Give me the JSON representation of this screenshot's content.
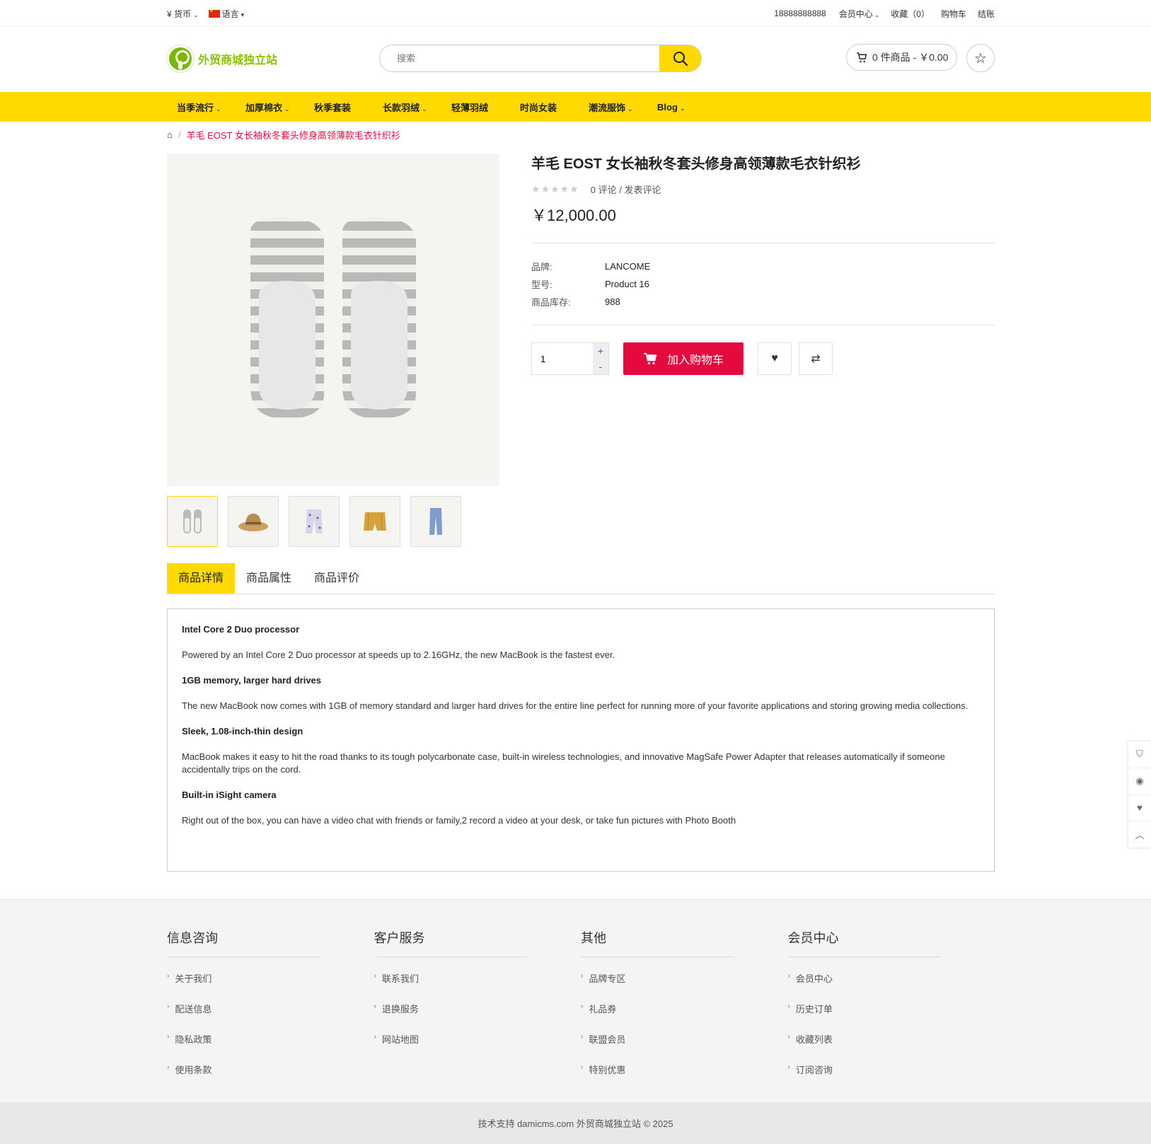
{
  "topbar": {
    "currency": "¥ 货币",
    "language": "语言",
    "phone": "18888888888",
    "account": "会员中心",
    "wishlist": "收藏（0）",
    "cart": "购物车",
    "checkout": "结账"
  },
  "header": {
    "logo_text": "外贸商城独立站",
    "search_placeholder": "搜索",
    "cart_summary": "0 件商品 - ￥0.00"
  },
  "nav": {
    "items": [
      {
        "label": "当季流行",
        "dropdown": true
      },
      {
        "label": "加厚棉衣",
        "dropdown": true
      },
      {
        "label": "秋季套装",
        "dropdown": false
      },
      {
        "label": "长款羽绒",
        "dropdown": true
      },
      {
        "label": "轻薄羽绒",
        "dropdown": false
      },
      {
        "label": "时尚女装",
        "dropdown": false
      },
      {
        "label": "潮流服饰",
        "dropdown": true
      },
      {
        "label": "Blog",
        "dropdown": true
      }
    ]
  },
  "breadcrumb": {
    "current": "羊毛 EOST 女长袖秋冬套头修身高领薄款毛衣针织衫"
  },
  "product": {
    "title": "羊毛 EOST 女长袖秋冬套头修身高领薄款毛衣针织衫",
    "rating": 0,
    "reviews_link": "0 评论",
    "write_review": "发表评论",
    "price": "￥12,000.00",
    "specs": [
      {
        "key": "品牌:",
        "value": "LANCOME"
      },
      {
        "key": "型号:",
        "value": "Product 16"
      },
      {
        "key": "商品库存:",
        "value": "988"
      }
    ],
    "quantity": "1",
    "add_to_cart": "加入购物车",
    "thumbnails": [
      "slippers",
      "straw-hat",
      "floral-pants",
      "yellow-shorts",
      "jeans"
    ]
  },
  "tabs": [
    {
      "label": "商品详情",
      "active": true
    },
    {
      "label": "商品属性",
      "active": false
    },
    {
      "label": "商品评价",
      "active": false
    }
  ],
  "description": [
    {
      "heading": "Intel Core 2 Duo processor",
      "body": "Powered by an Intel Core 2 Duo processor at speeds up to 2.16GHz, the new MacBook is the fastest ever."
    },
    {
      "heading": "1GB memory, larger hard drives",
      "body": "The new MacBook now comes with 1GB of memory standard and larger hard drives for the entire line perfect for running more of your favorite applications and storing growing media collections."
    },
    {
      "heading": "Sleek, 1.08-inch-thin design",
      "body": "MacBook makes it easy to hit the road thanks to its tough polycarbonate case, built-in wireless technologies, and innovative MagSafe Power Adapter that releases automatically if someone accidentally trips on the cord."
    },
    {
      "heading": "Built-in iSight camera",
      "body": "Right out of the box, you can have a video chat with friends or family,2 record a video at your desk, or take fun pictures with Photo Booth"
    }
  ],
  "footer": {
    "columns": [
      {
        "title": "信息咨询",
        "links": [
          "关于我们",
          "配送信息",
          "隐私政策",
          "使用条款"
        ]
      },
      {
        "title": "客户服务",
        "links": [
          "联系我们",
          "退换服务",
          "网站地图"
        ]
      },
      {
        "title": "其他",
        "links": [
          "品牌专区",
          "礼品券",
          "联盟会员",
          "特别优惠"
        ]
      },
      {
        "title": "会员中心",
        "links": [
          "会员中心",
          "历史订单",
          "收藏列表",
          "订阅咨询"
        ]
      }
    ],
    "copyright": "技术支持 damicms.com 外贸商城独立站 © 2025"
  },
  "colors": {
    "accent_yellow": "#ffd900",
    "accent_red": "#e4093f",
    "logo_green": "#8cc10a"
  }
}
